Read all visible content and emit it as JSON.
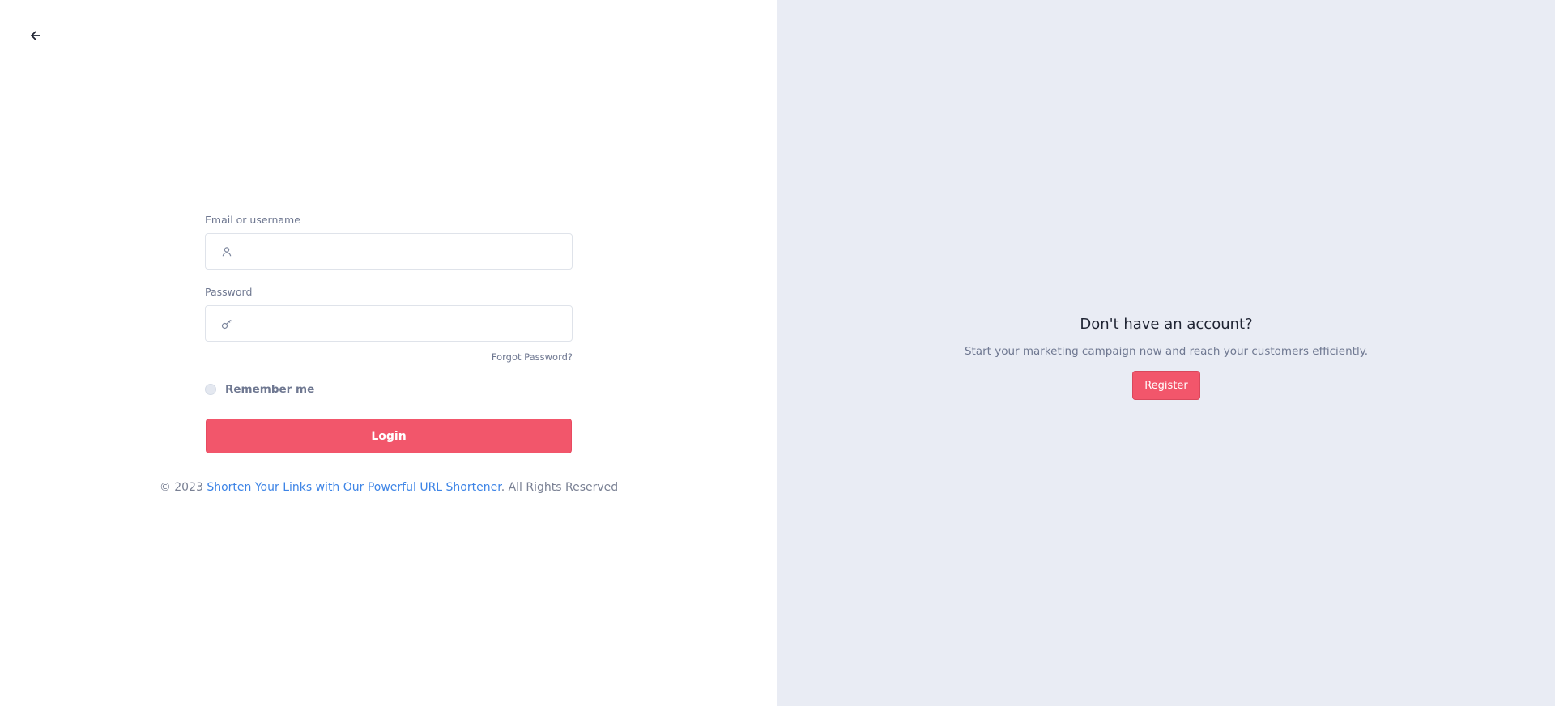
{
  "back": {
    "icon": "arrow-left-icon"
  },
  "login_form": {
    "email": {
      "label": "Email or username",
      "icon": "user-icon",
      "value": "",
      "placeholder": ""
    },
    "password": {
      "label": "Password",
      "icon": "key-icon",
      "value": "",
      "placeholder": ""
    },
    "forgot_password": "Forgot Password?",
    "remember_me": "Remember me",
    "submit": "Login"
  },
  "footer": {
    "prefix": "© 2023 ",
    "link": "Shorten Your Links with Our Powerful URL Shortener",
    "suffix": ". All Rights Reserved"
  },
  "register_panel": {
    "title": "Don't have an account?",
    "subtitle": "Start your marketing campaign now and reach your customers efficiently.",
    "button": "Register"
  },
  "colors": {
    "accent": "#f2566b",
    "link": "#3d84e6",
    "panel_background": "#e9ecf4"
  }
}
